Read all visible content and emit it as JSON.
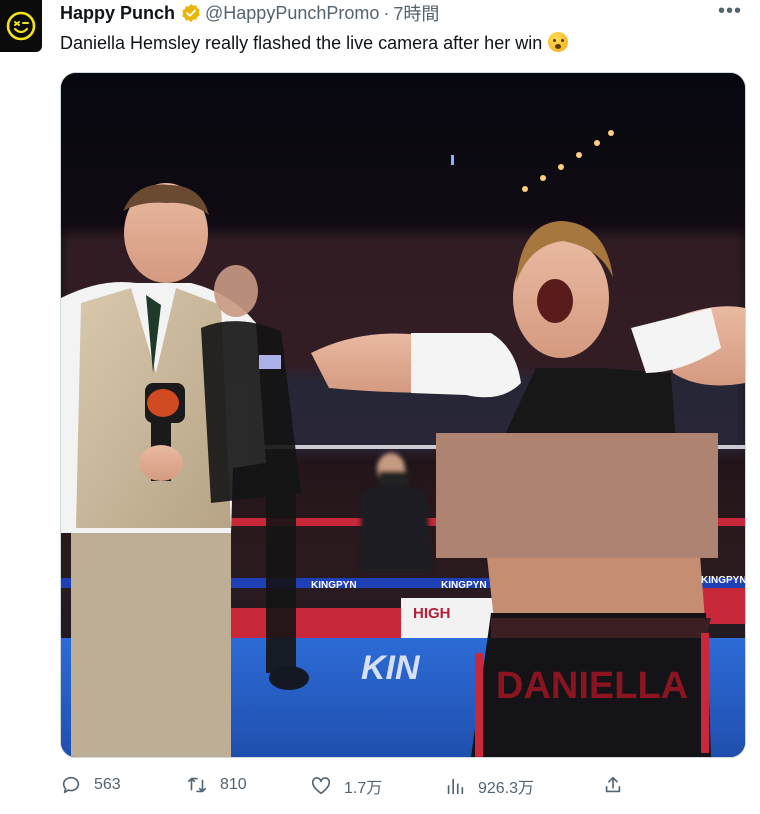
{
  "author": {
    "name": "Happy Punch",
    "handle": "@HappyPunchPromo",
    "separator": "·",
    "time": "7時間",
    "avatar_icon": "smiley-face-logo",
    "verified_icon": "verified-badge-gold"
  },
  "tweet": {
    "text": "Daniella Hemsley really flashed the live camera after her win",
    "emoji_icon": "flushed-face-emoji"
  },
  "media": {
    "type": "video-still",
    "banner_texts": [
      "KINGPYN",
      "KINGPYN",
      "HIGH",
      "KINGPYN"
    ],
    "floor_text": "KIN",
    "shorts_text": "DANIELLA"
  },
  "actions": {
    "replies": "563",
    "retweets": "810",
    "likes": "1.7万",
    "views": "926.3万"
  },
  "colors": {
    "text": "#0f1419",
    "secondary": "#536471",
    "verified": "#e8b50a"
  }
}
